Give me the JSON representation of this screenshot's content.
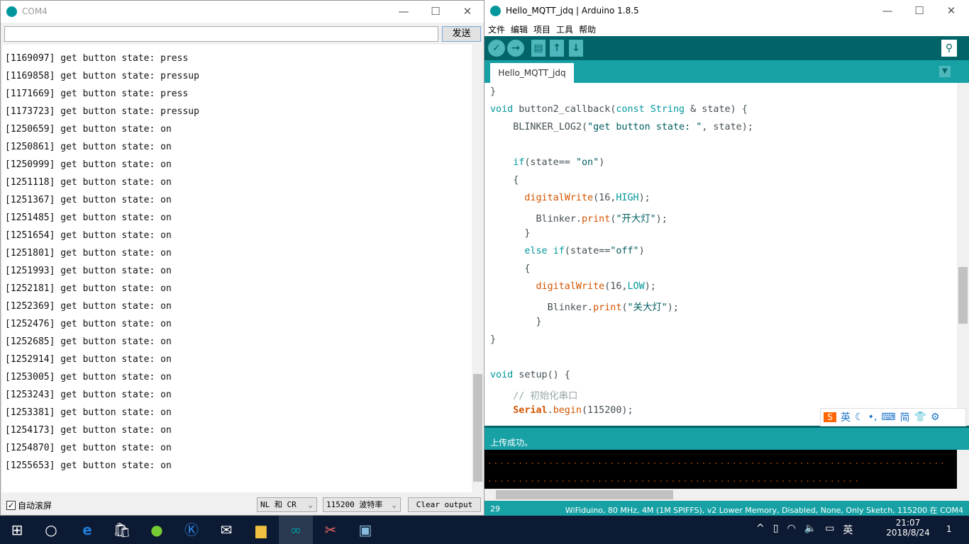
{
  "serial_monitor": {
    "title": "COM4",
    "send_input_value": "",
    "send_button": "发送",
    "lines": [
      "[1169097] get button state: press",
      "[1169858] get button state: pressup",
      "[1171669] get button state: press",
      "[1173723] get button state: pressup",
      "[1250659] get button state: on",
      "[1250861] get button state: on",
      "[1250999] get button state: on",
      "[1251118] get button state: on",
      "[1251367] get button state: on",
      "[1251485] get button state: on",
      "[1251654] get button state: on",
      "[1251801] get button state: on",
      "[1251993] get button state: on",
      "[1252181] get button state: on",
      "[1252369] get button state: on",
      "[1252476] get button state: on",
      "[1252685] get button state: on",
      "[1252914] get button state: on",
      "[1253005] get button state: on",
      "[1253243] get button state: on",
      "[1253381] get button state: on",
      "[1254173] get button state: on",
      "[1254870] get button state: on",
      "[1255653] get button state: on"
    ],
    "autoscroll_label": "自动滚屏",
    "autoscroll_checked": true,
    "line_ending": "NL 和 CR",
    "baud_rate": "115200 波特率",
    "clear_button": "Clear output"
  },
  "ide": {
    "title": "Hello_MQTT_jdq | Arduino 1.8.5",
    "menu": [
      "文件",
      "编辑",
      "项目",
      "工具",
      "帮助"
    ],
    "tab": "Hello_MQTT_jdq",
    "code": [
      [
        [
          "}",
          ""
        ]
      ],
      [
        [
          "void",
          "kw"
        ],
        [
          " button2_callback(",
          ""
        ],
        [
          "const",
          "kw"
        ],
        [
          " ",
          ""
        ],
        [
          "String",
          "kw"
        ],
        [
          " & state) {",
          ""
        ]
      ],
      [
        [
          "    BLINKER_LOG2(",
          ""
        ],
        [
          "\"get button state: \"",
          "st"
        ],
        [
          ", state);",
          ""
        ]
      ],
      [],
      [
        [
          "    ",
          ""
        ],
        [
          "if",
          "kw"
        ],
        [
          "(state== ",
          ""
        ],
        [
          "\"on\"",
          "st"
        ],
        [
          ")",
          ""
        ]
      ],
      [
        [
          "    {",
          ""
        ]
      ],
      [
        [
          "      ",
          ""
        ],
        [
          "digitalWrite",
          "fn"
        ],
        [
          "(16,",
          ""
        ],
        [
          "HIGH",
          "cn"
        ],
        [
          ");",
          ""
        ]
      ],
      [
        [
          "        Blinker.",
          ""
        ],
        [
          "print",
          "fn"
        ],
        [
          "(",
          ""
        ],
        [
          "\"开大灯\"",
          "st"
        ],
        [
          ");",
          ""
        ]
      ],
      [
        [
          "      }",
          ""
        ]
      ],
      [
        [
          "      ",
          ""
        ],
        [
          "else",
          "kw"
        ],
        [
          " ",
          ""
        ],
        [
          "if",
          "kw"
        ],
        [
          "(state==",
          ""
        ],
        [
          "\"off\"",
          "st"
        ],
        [
          ")",
          ""
        ]
      ],
      [
        [
          "      {",
          ""
        ]
      ],
      [
        [
          "        ",
          ""
        ],
        [
          "digitalWrite",
          "fn"
        ],
        [
          "(16,",
          ""
        ],
        [
          "LOW",
          "cn"
        ],
        [
          ");",
          ""
        ]
      ],
      [
        [
          "          Blinker.",
          ""
        ],
        [
          "print",
          "fn"
        ],
        [
          "(",
          ""
        ],
        [
          "\"关大灯\"",
          "st"
        ],
        [
          ");",
          ""
        ]
      ],
      [
        [
          "        }",
          ""
        ]
      ],
      [
        [
          "}",
          ""
        ]
      ],
      [],
      [
        [
          "void",
          "kw"
        ],
        [
          " setup() {",
          ""
        ]
      ],
      [
        [
          "    ",
          ""
        ],
        [
          "// 初始化串口",
          "cm"
        ]
      ],
      [
        [
          "    ",
          ""
        ],
        [
          "Serial",
          "bd"
        ],
        [
          ".",
          ""
        ],
        [
          "begin",
          "fn"
        ],
        [
          "(115200);",
          ""
        ]
      ]
    ],
    "status_message": "上传成功。",
    "console_lines": [
      "...........................................................................",
      "............................................................."
    ],
    "line_number": "29",
    "board_info": "WiFiduino, 80 MHz, 4M (1M SPIFFS), v2 Lower Memory, Disabled, None, Only Sketch, 115200 在 COM4"
  },
  "ime_bar": {
    "mode": "英",
    "simplified": "简"
  },
  "taskbar": {
    "ime": "英",
    "time": "21:07",
    "date": "2018/8/24",
    "notification_count": "1"
  },
  "colors": {
    "teal_dark": "#006468",
    "teal": "#17a1a5",
    "keyword": "#00979c",
    "function": "#d35400"
  }
}
